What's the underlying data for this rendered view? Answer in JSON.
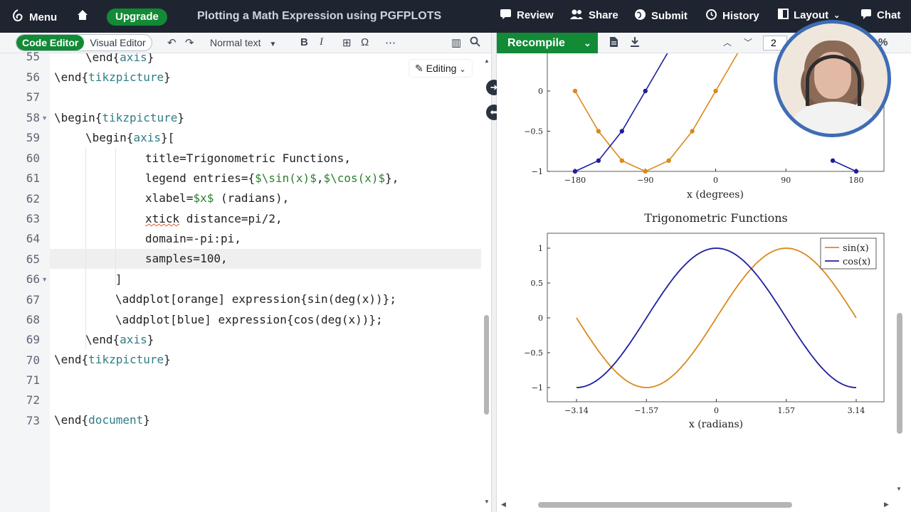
{
  "topbar": {
    "menu": "Menu",
    "upgrade": "Upgrade",
    "title": "Plotting a Math Expression using PGFPLOTS",
    "review": "Review",
    "share": "Share",
    "submit": "Submit",
    "history": "History",
    "layout": "Layout",
    "chat": "Chat"
  },
  "editor_toolbar": {
    "code_editor": "Code Editor",
    "visual_editor": "Visual Editor",
    "text_style": "Normal text"
  },
  "editing_badge": "Editing",
  "code": {
    "line_numbers": [
      "55",
      "56",
      "57",
      "58",
      "59",
      "60",
      "61",
      "62",
      "63",
      "64",
      "65",
      "66",
      "67",
      "68",
      "69",
      "70",
      "71",
      "72",
      "73"
    ],
    "l55a": "\\end{",
    "l55b": "axis",
    "l55c": "}",
    "l56a": "\\end{",
    "l56b": "tikzpicture",
    "l56c": "}",
    "l58a": "\\begin{",
    "l58b": "tikzpicture",
    "l58c": "}",
    "l59a": "\\begin{",
    "l59b": "axis",
    "l59c": "}[",
    "l60": "title=Trigonometric Functions,",
    "l61a": "legend entries={",
    "l61b": "$\\sin(x)$",
    "l61c": ",",
    "l61d": "$\\cos(x)$",
    "l61e": "},",
    "l62a": "xlabel=",
    "l62b": "$x$",
    "l62c": " (radians),",
    "l63a": "xtick",
    "l63b": " distance=pi/2,",
    "l64": "domain=-pi:pi,",
    "l65": "samples=100,",
    "l66": "]",
    "l67": "\\addplot[orange] expression{sin(deg(x))};",
    "l68": "\\addplot[blue] expression{cos(deg(x))};",
    "l69a": "\\end{",
    "l69b": "axis",
    "l69c": "}",
    "l70a": "\\end{",
    "l70b": "tikzpicture",
    "l70c": "}",
    "l73a": "\\end{",
    "l73b": "document",
    "l73c": "}"
  },
  "preview_toolbar": {
    "recompile": "Recompile",
    "page": "2",
    "zoom_fragment": "%"
  },
  "colors": {
    "topbar": "#1e2530",
    "green": "#138a36",
    "orange": "#d98a1c",
    "blue": "#1f1f9e"
  },
  "chart_data": [
    {
      "type": "line",
      "title": "",
      "xlabel": "x (degrees)",
      "ylabel": "",
      "xticks": [
        "−180",
        "−90",
        "0",
        "90",
        "180"
      ],
      "yticks": [
        "0",
        "−0.5",
        "−1"
      ],
      "xlim": [
        -180,
        180
      ],
      "ylim": [
        -1,
        0
      ],
      "marker": "circle",
      "series": [
        {
          "name": "",
          "color": "#d98a1c",
          "x": [
            -180,
            -150,
            -120,
            -90,
            -60,
            -30,
            0,
            30,
            60
          ],
          "y": [
            0,
            -0.5,
            -0.866,
            -1,
            -0.866,
            -0.5,
            0,
            0.5,
            0.866
          ]
        },
        {
          "name": "",
          "color": "#1f1f9e",
          "x": [
            -180,
            -150,
            -120,
            -90,
            -60,
            -30,
            150,
            180
          ],
          "y": [
            -1,
            -0.866,
            -0.5,
            0,
            0.5,
            0.866,
            -0.866,
            -1
          ]
        }
      ]
    },
    {
      "type": "line",
      "title": "Trigonometric Functions",
      "xlabel": "x (radians)",
      "ylabel": "",
      "xticks": [
        "−3.14",
        "−1.57",
        "0",
        "1.57",
        "3.14"
      ],
      "yticks": [
        "1",
        "0.5",
        "0",
        "−0.5",
        "−1"
      ],
      "xlim": [
        -3.14159,
        3.14159
      ],
      "ylim": [
        -1,
        1
      ],
      "legend_position": "top-right",
      "series": [
        {
          "name": "sin(x)",
          "color": "#d98a1c",
          "function": "sin"
        },
        {
          "name": "cos(x)",
          "color": "#1f1f9e",
          "function": "cos"
        }
      ]
    }
  ]
}
